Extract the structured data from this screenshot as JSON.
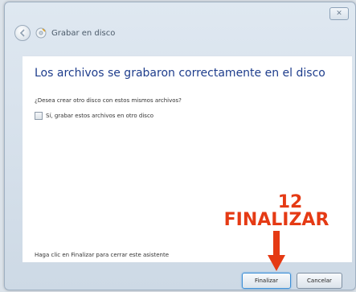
{
  "window": {
    "title": "Grabar en disco",
    "close_glyph": "✕"
  },
  "content": {
    "heading": "Los archivos se grabaron correctamente en el disco",
    "question": "¿Desea crear otro disco con estos mismos archivos?",
    "checkbox_label": "Sí, grabar estos archivos en otro disco",
    "checkbox_checked": false,
    "hint": "Haga clic en Finalizar para cerrar este asistente"
  },
  "annotation": {
    "step": "12",
    "label": "FINALIZAR",
    "color": "#e53a14"
  },
  "buttons": {
    "finish": "Finalizar",
    "cancel": "Cancelar"
  },
  "icons": [
    "back-arrow-icon",
    "disc-icon",
    "close-icon",
    "down-arrow-icon"
  ]
}
